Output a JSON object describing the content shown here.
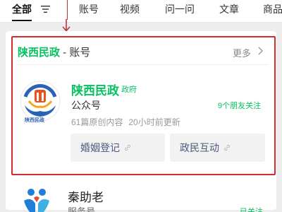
{
  "tabs": [
    {
      "label": "全部"
    },
    {
      "label": "账号"
    },
    {
      "label": "视频"
    },
    {
      "label": "问一问"
    },
    {
      "label": "文章"
    },
    {
      "label": "商品"
    }
  ],
  "colors": {
    "accent": "#07c160",
    "highlight": "#d42b30",
    "chip_text": "#4a5b7c"
  },
  "section": {
    "brand": "陕西民政",
    "suffix": " - 账号",
    "more_label": "更多"
  },
  "account": {
    "name": "陕西民政",
    "badge": "政府",
    "type": "公众号",
    "friends": "9个朋友关注",
    "articles": "61篇原创内容",
    "updated": "20小时前更新",
    "logo_text": "陕西民政"
  },
  "menus": [
    {
      "label": "婚姻登记"
    },
    {
      "label": "政民互动"
    }
  ],
  "next_result": {
    "name": "秦助老",
    "type": "服务号",
    "follow": "已关注"
  },
  "icons": {
    "filter": "filter-icon",
    "more": "chevron-right-icon",
    "link": "link-icon",
    "arrow": "red-arrow-annotation"
  }
}
